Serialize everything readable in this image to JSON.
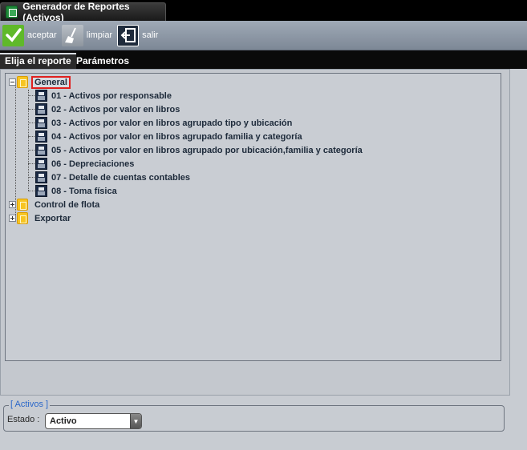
{
  "window": {
    "title": "Generador de Reportes (Activos)",
    "icon": "report-generator-icon"
  },
  "toolbar": {
    "accept_label": "aceptar",
    "clear_label": "limpiar",
    "exit_label": "salir"
  },
  "tabs": [
    {
      "label": "Elija el reporte",
      "active": true
    },
    {
      "label": "Parámetros",
      "active": false
    }
  ],
  "tree": {
    "root": {
      "label": "General",
      "expanded": true,
      "selected": true
    },
    "reports": [
      {
        "label": "01 - Activos por responsable"
      },
      {
        "label": "02 - Activos por valor en libros"
      },
      {
        "label": "03 - Activos por valor en libros agrupado tipo y ubicación"
      },
      {
        "label": "04 - Activos por valor en libros agrupado familia y categoría"
      },
      {
        "label": "05 - Activos por valor en libros agrupado por ubicación,familia y categoría"
      },
      {
        "label": "06 - Depreciaciones"
      },
      {
        "label": "07 - Detalle de cuentas contables"
      },
      {
        "label": "08 - Toma física"
      }
    ],
    "other_groups": [
      {
        "label": "Control de flota",
        "expanded": false
      },
      {
        "label": "Exportar",
        "expanded": false
      }
    ]
  },
  "filter": {
    "legend": "[ Activos ]",
    "estado_label": "Estado :",
    "estado_value": "Activo"
  },
  "colors": {
    "accent_blue": "#2a67c9",
    "selection_outline": "#e0201e",
    "folder_yellow": "#f7c522"
  }
}
